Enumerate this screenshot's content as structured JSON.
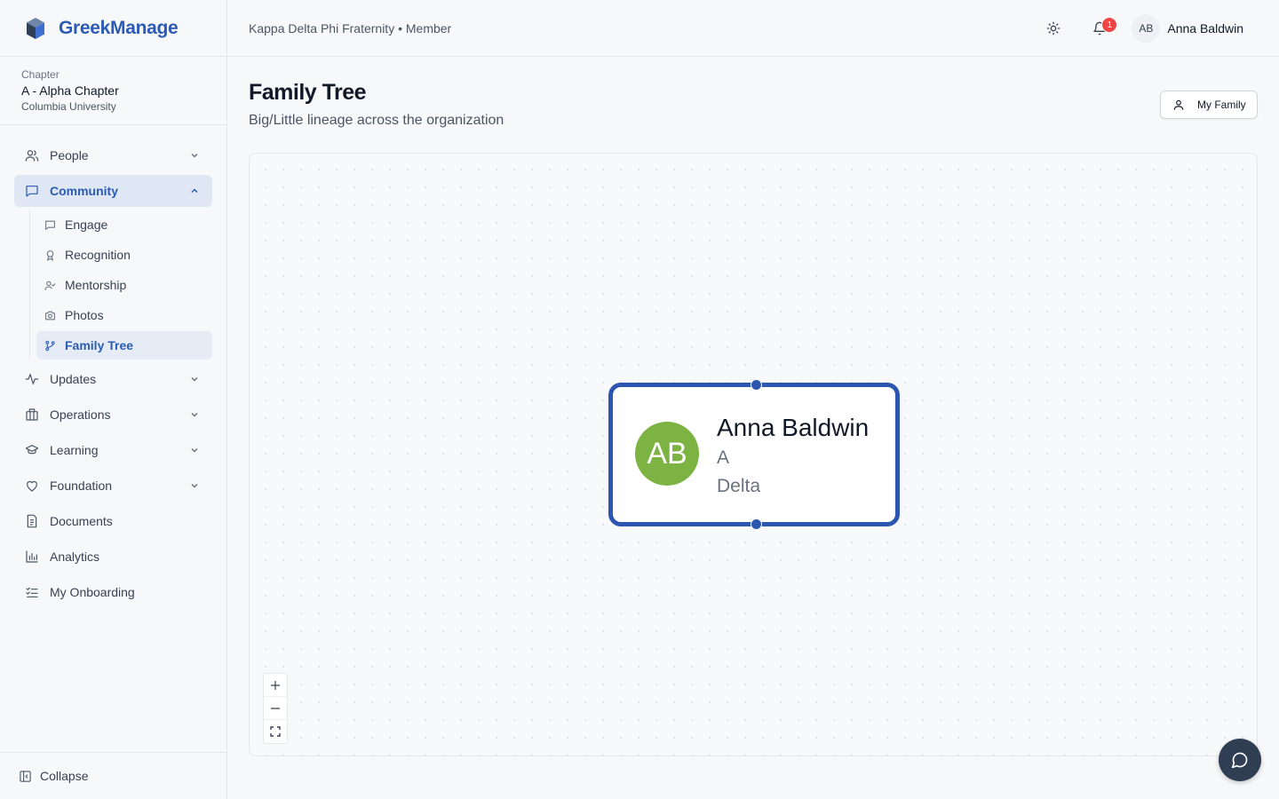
{
  "brand": {
    "name": "GreekManage"
  },
  "chapter": {
    "caption": "Chapter",
    "name": "A - Alpha Chapter",
    "university": "Columbia University"
  },
  "sidebar": {
    "items": [
      {
        "label": "People"
      },
      {
        "label": "Community"
      },
      {
        "label": "Updates"
      },
      {
        "label": "Operations"
      },
      {
        "label": "Learning"
      },
      {
        "label": "Foundation"
      },
      {
        "label": "Documents"
      },
      {
        "label": "Analytics"
      },
      {
        "label": "My Onboarding"
      }
    ],
    "community_sub": [
      {
        "label": "Engage"
      },
      {
        "label": "Recognition"
      },
      {
        "label": "Mentorship"
      },
      {
        "label": "Photos"
      },
      {
        "label": "Family Tree"
      }
    ],
    "collapse_label": "Collapse"
  },
  "topbar": {
    "breadcrumb": "Kappa Delta Phi Fraternity • Member",
    "notification_count": "1",
    "user_initials": "AB",
    "user_name": "Anna Baldwin"
  },
  "page": {
    "title": "Family Tree",
    "subtitle": "Big/Little lineage across the organization",
    "my_family_label": "My Family"
  },
  "tree": {
    "node": {
      "initials": "AB",
      "name": "Anna Baldwin",
      "line1": "A",
      "line2": "Delta",
      "avatar_color": "#7cb342"
    }
  },
  "zoom": {
    "in": "+",
    "out": "—"
  },
  "colors": {
    "accent": "#2c5bb5",
    "node_border": "#2c56b0",
    "badge": "#ef4444",
    "chat_bg": "#2f3e52"
  }
}
